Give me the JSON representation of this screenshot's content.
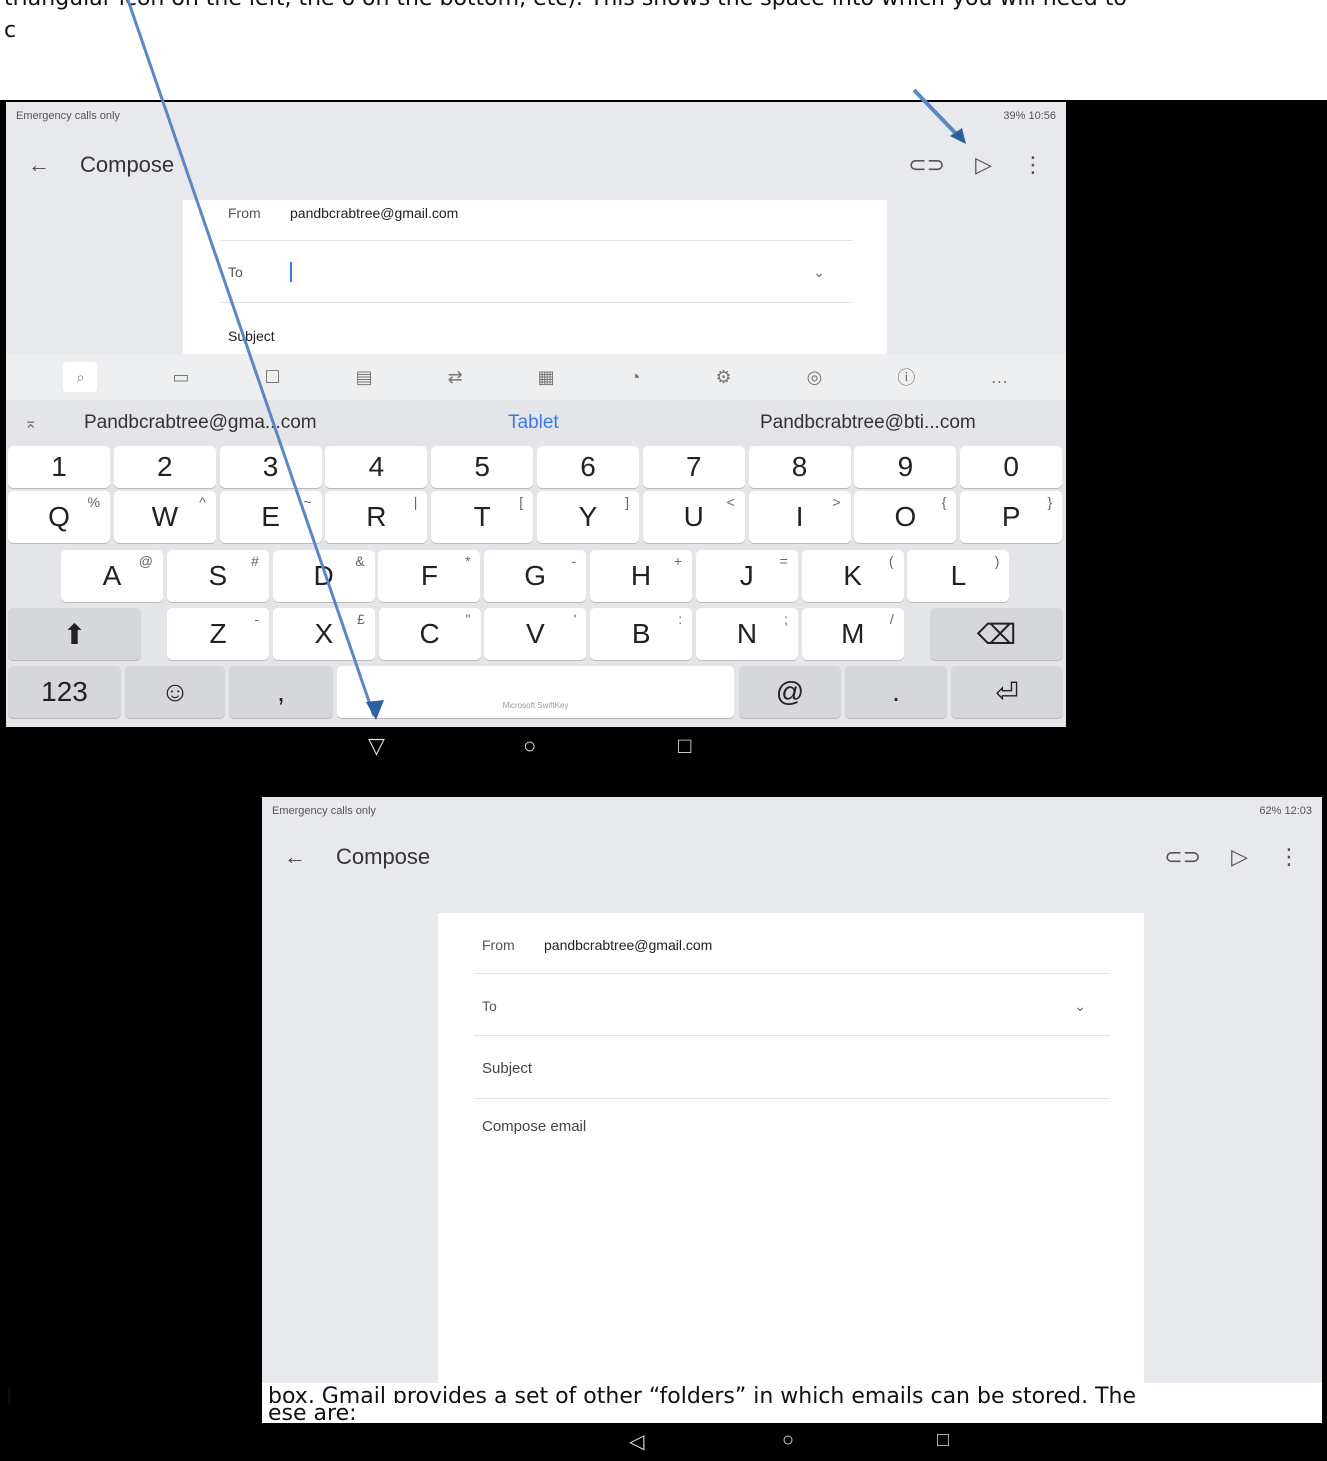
{
  "doc": {
    "top_line": "triangular icon on the left, the o on the bottom, etc). This shows the space into which you will need to",
    "second_line": "c",
    "caption_line1": "box, Gmail provides a set of other “folders” in which emails can be stored. The",
    "caption_line2": "ese are:",
    "caption_left": "I"
  },
  "screen1": {
    "status_left": "Emergency calls only",
    "status_right": "39%  10:56",
    "title": "Compose",
    "from_label": "From",
    "from_value": "pandbcrabtree@gmail.com",
    "to_label": "To",
    "subject_label": "Subject",
    "suggestions": [
      "Pandbcrabtree@gma...com",
      "Tablet",
      "Pandbcrabtree@bti...com"
    ],
    "keys_num": [
      "1",
      "2",
      "3",
      "4",
      "5",
      "6",
      "7",
      "8",
      "9",
      "0"
    ],
    "keys_row1": [
      [
        "Q",
        "%"
      ],
      [
        "W",
        "^"
      ],
      [
        "E",
        "~"
      ],
      [
        "R",
        "|"
      ],
      [
        "T",
        "["
      ],
      [
        "Y",
        "]"
      ],
      [
        "U",
        "<"
      ],
      [
        "I",
        ">"
      ],
      [
        "O",
        "{"
      ],
      [
        "P",
        "}"
      ]
    ],
    "keys_row2": [
      [
        "A",
        "@"
      ],
      [
        "S",
        "#"
      ],
      [
        "D",
        "&"
      ],
      [
        "F",
        "*"
      ],
      [
        "G",
        "-"
      ],
      [
        "H",
        "+"
      ],
      [
        "J",
        "="
      ],
      [
        "K",
        "("
      ],
      [
        "L",
        ")"
      ]
    ],
    "keys_row3": [
      [
        "Z",
        "-"
      ],
      [
        "X",
        "£"
      ],
      [
        "C",
        "\""
      ],
      [
        "V",
        "'"
      ],
      [
        "B",
        ":"
      ],
      [
        "N",
        ";"
      ],
      [
        "M",
        "/"
      ]
    ],
    "key_123": "123",
    "key_comma": ",",
    "key_at": "@",
    "key_period": ".",
    "brand": "Microsoft SwiftKey"
  },
  "screen2": {
    "status_left": "Emergency calls only",
    "status_right": "62%  12:03",
    "title": "Compose",
    "from_label": "From",
    "from_value": "pandbcrabtree@gmail.com",
    "to_label": "To",
    "subject_label": "Subject",
    "body_placeholder": "Compose email"
  }
}
